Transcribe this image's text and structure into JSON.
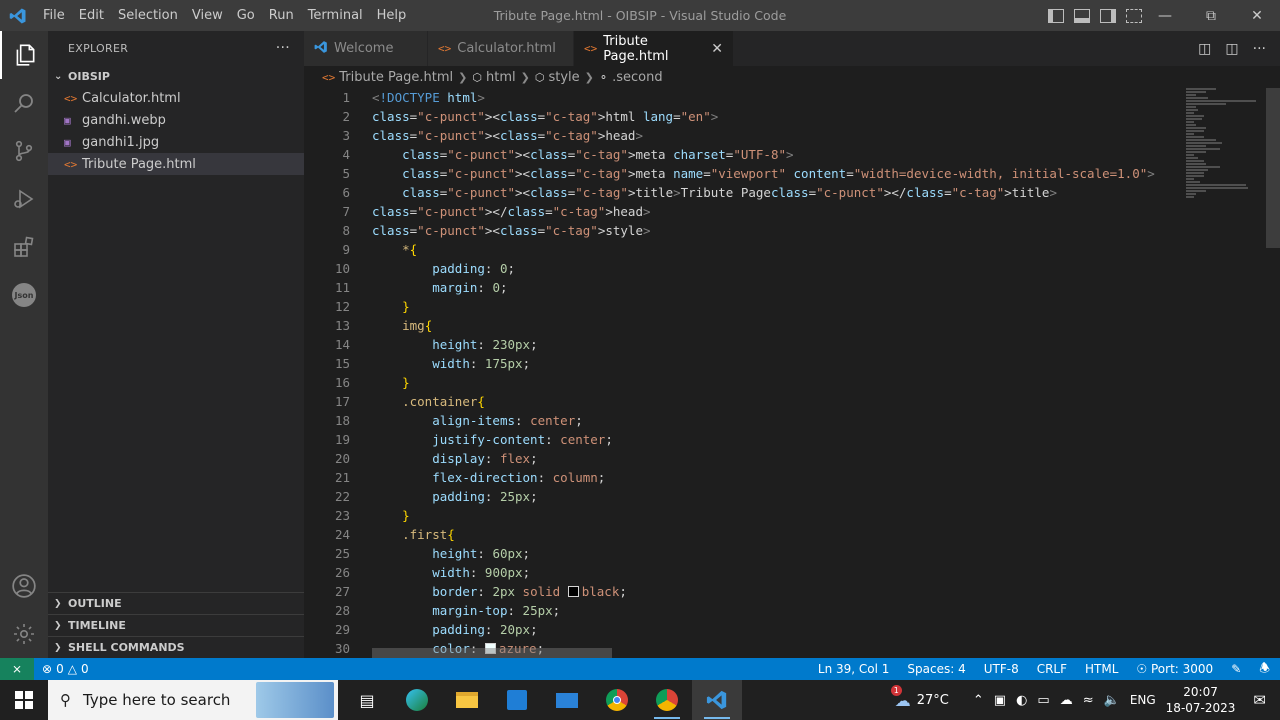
{
  "window": {
    "title": "Tribute Page.html - OIBSIP - Visual Studio Code",
    "menu": [
      "File",
      "Edit",
      "Selection",
      "View",
      "Go",
      "Run",
      "Terminal",
      "Help"
    ]
  },
  "activity_icons": [
    "explorer-icon",
    "search-icon",
    "source-control-icon",
    "run-debug-icon",
    "extensions-icon",
    "json-icon"
  ],
  "json_badge": "Json",
  "explorer": {
    "header": "EXPLORER",
    "more": "···",
    "folder": "OIBSIP",
    "files": [
      {
        "name": "Calculator.html",
        "type": "html"
      },
      {
        "name": "gandhi.webp",
        "type": "img"
      },
      {
        "name": "gandhi1.jpg",
        "type": "img"
      },
      {
        "name": "Tribute Page.html",
        "type": "html"
      }
    ],
    "sections": [
      "OUTLINE",
      "TIMELINE",
      "SHELL COMMANDS"
    ]
  },
  "tabs": [
    {
      "label": "Welcome",
      "icon": "vscode-icon"
    },
    {
      "label": "Calculator.html",
      "icon": "html-icon"
    },
    {
      "label": "Tribute Page.html",
      "icon": "html-icon"
    }
  ],
  "breadcrumb": {
    "file": "Tribute Page.html",
    "html": "html",
    "style": "style",
    "selector": ".second"
  },
  "code_lines": [
    "<!DOCTYPE html>",
    "<html lang=\"en\">",
    "<head>",
    "    <meta charset=\"UTF-8\">",
    "    <meta name=\"viewport\" content=\"width=device-width, initial-scale=1.0\">",
    "    <title>Tribute Page</title>",
    "</head>",
    "<style>",
    "    *{",
    "        padding: 0;",
    "        margin: 0;",
    "    }",
    "    img{",
    "        height: 230px;",
    "        width: 175px;",
    "    }",
    "    .container{",
    "        align-items: center;",
    "        justify-content: center;",
    "        display: flex;",
    "        flex-direction: column;",
    "        padding: 25px;",
    "    }",
    "    .first{",
    "        height: 60px;",
    "        width: 900px;",
    "        border: 2px solid black;",
    "        margin-top: 25px;",
    "        padding: 20px;",
    "        color: azure;"
  ],
  "status": {
    "errors": "0",
    "warnings": "0",
    "position": "Ln 39, Col 1",
    "spaces": "Spaces: 4",
    "encoding": "UTF-8",
    "eol": "CRLF",
    "language": "HTML",
    "port": "Port: 3000"
  },
  "taskbar": {
    "search_placeholder": "Type here to search",
    "weather": "27°C",
    "weather_badge": "1",
    "language": "ENG",
    "time": "20:07",
    "date": "18-07-2023"
  },
  "colors": {
    "accent": "#007acc",
    "remote": "#16825d",
    "titlebar": "#3c3c3c"
  }
}
